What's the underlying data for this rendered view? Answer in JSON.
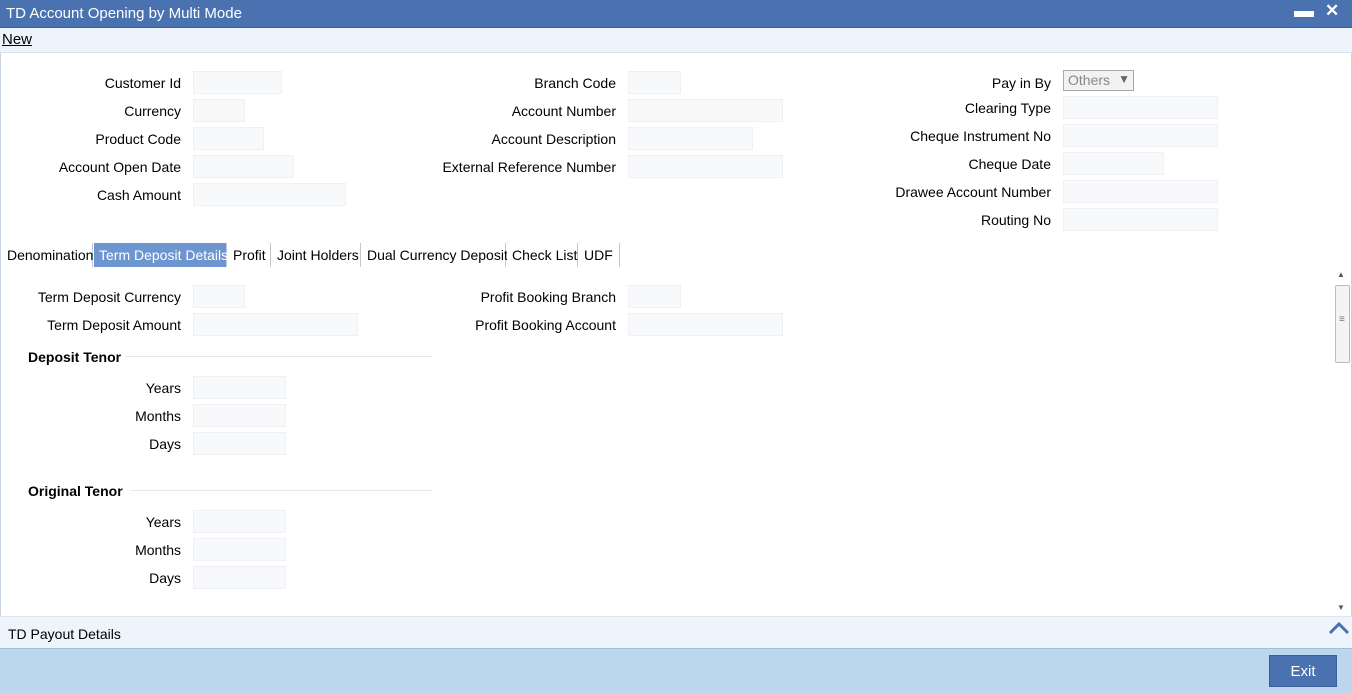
{
  "window": {
    "title": "TD Account Opening by Multi Mode",
    "minimize": "▬",
    "close": "✕"
  },
  "menu": {
    "new_label": "New"
  },
  "header": {
    "customer_id": "Customer Id",
    "currency": "Currency",
    "product_code": "Product Code",
    "account_open_date": "Account Open Date",
    "cash_amount": "Cash Amount",
    "branch_code": "Branch Code",
    "account_number": "Account Number",
    "account_description": "Account Description",
    "external_reference_number": "External Reference Number",
    "pay_in_by": "Pay in By",
    "pay_in_by_value": "Others",
    "clearing_type": "Clearing Type",
    "cheque_instrument_no": "Cheque Instrument No",
    "cheque_date": "Cheque Date",
    "drawee_account_number": "Drawee Account Number",
    "routing_no": "Routing No"
  },
  "tabs": [
    {
      "label": "Denomination"
    },
    {
      "label": "Term Deposit Details",
      "active": true
    },
    {
      "label": "Profit"
    },
    {
      "label": "Joint Holders"
    },
    {
      "label": "Dual Currency Deposit"
    },
    {
      "label": "Check List"
    },
    {
      "label": "UDF"
    }
  ],
  "term_deposit": {
    "currency": "Term Deposit Currency",
    "amount": "Term Deposit Amount",
    "profit_booking_branch": "Profit Booking Branch",
    "profit_booking_account": "Profit Booking Account"
  },
  "deposit_tenor": {
    "title": "Deposit Tenor",
    "years": "Years",
    "months": "Months",
    "days": "Days"
  },
  "original_tenor": {
    "title": "Original Tenor",
    "years": "Years",
    "months": "Months",
    "days": "Days"
  },
  "payout": {
    "label": "TD Payout Details"
  },
  "footer": {
    "exit_label": "Exit"
  },
  "icons": {
    "dropdown": "chevron-down-icon",
    "expand": "chevron-up-icon"
  }
}
